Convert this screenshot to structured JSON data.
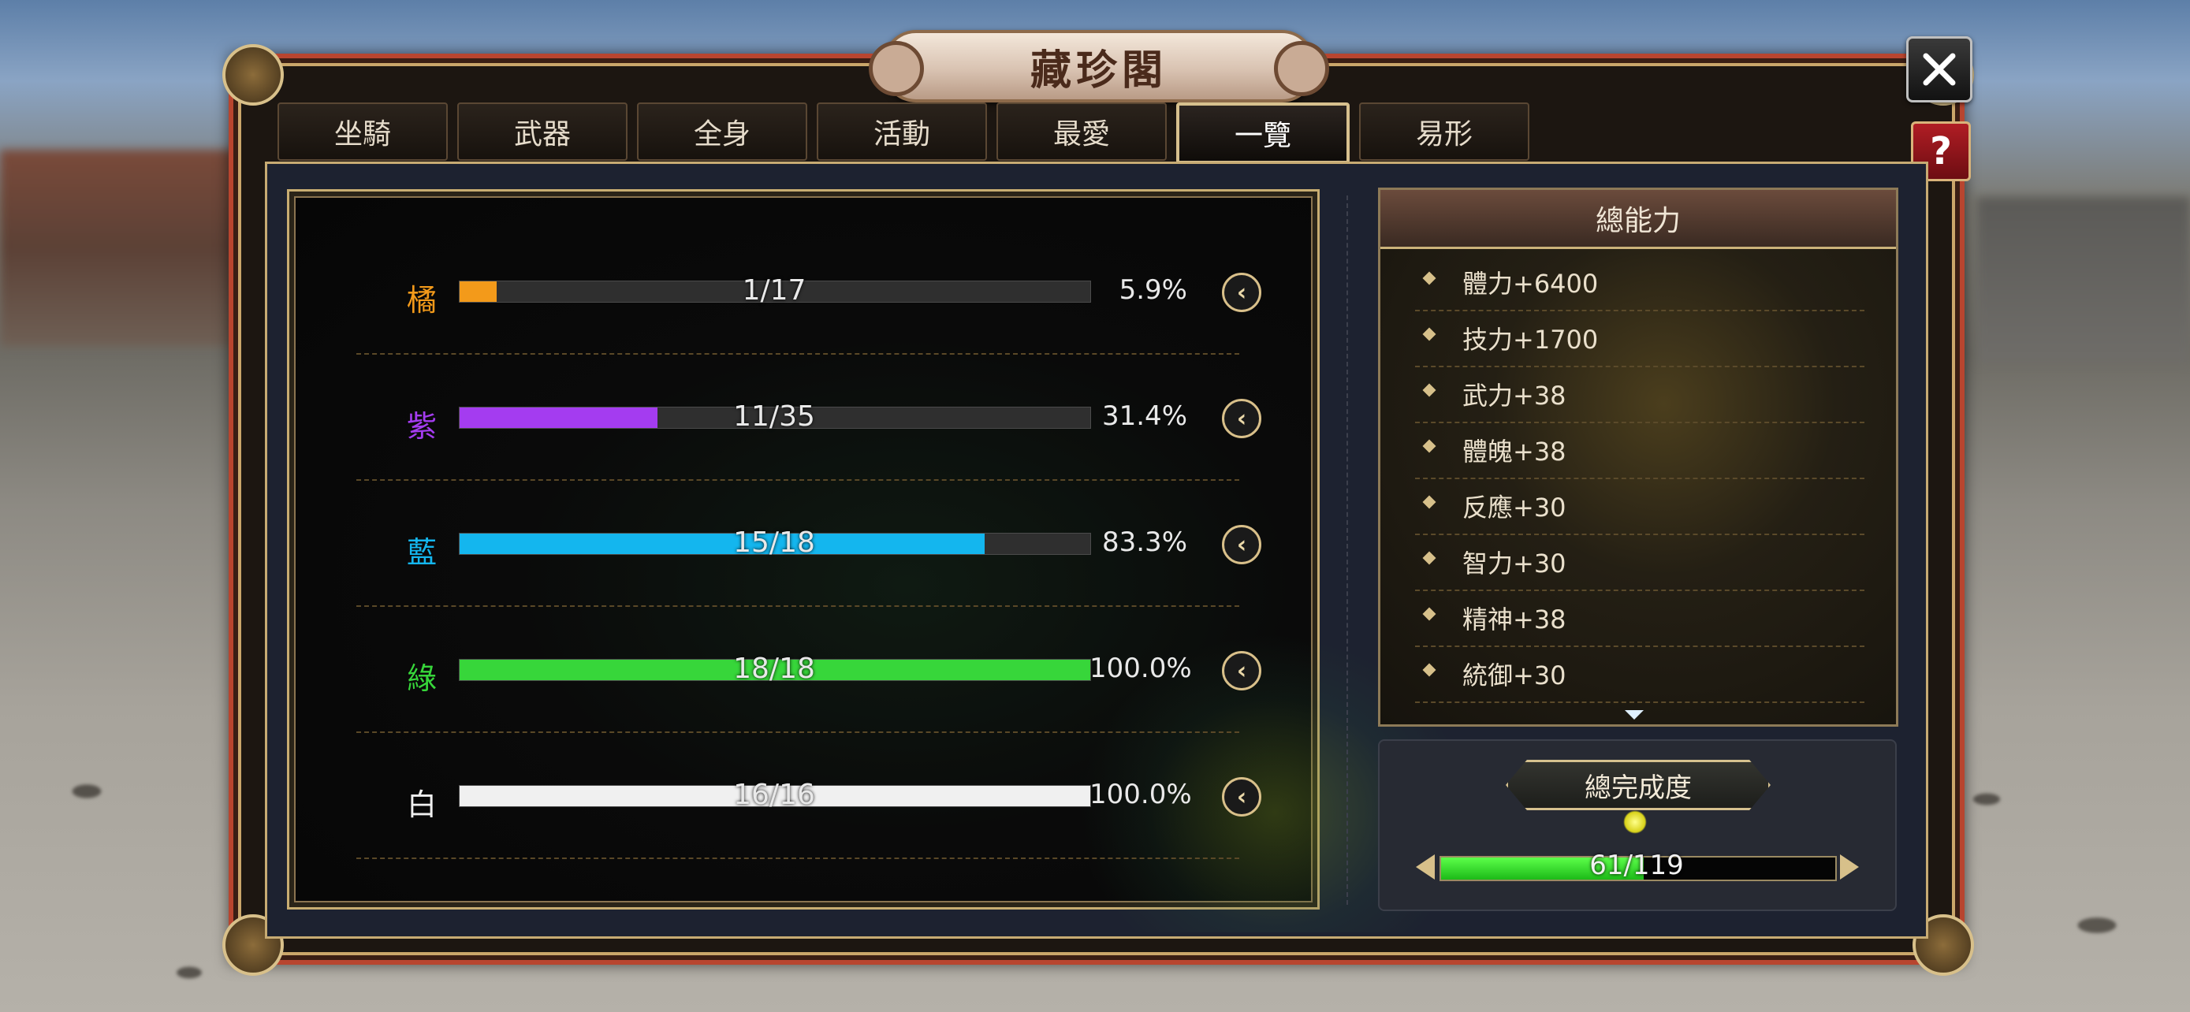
{
  "window": {
    "title": "藏珍閣"
  },
  "buttons": {
    "close_icon": "close-icon",
    "help_label": "?"
  },
  "tabs": [
    {
      "label": "坐騎"
    },
    {
      "label": "武器"
    },
    {
      "label": "全身"
    },
    {
      "label": "活動"
    },
    {
      "label": "最愛"
    },
    {
      "label": "一覽",
      "active": true
    },
    {
      "label": "易形"
    }
  ],
  "rarity_rows": [
    {
      "label": "橘",
      "progress": "1/17",
      "percent": "5.9%",
      "fraction": 0.059,
      "color": "#f39a1a"
    },
    {
      "label": "紫",
      "progress": "11/35",
      "percent": "31.4%",
      "fraction": 0.314,
      "color": "#a43cf0"
    },
    {
      "label": "藍",
      "progress": "15/18",
      "percent": "83.3%",
      "fraction": 0.833,
      "color": "#14b6ee"
    },
    {
      "label": "綠",
      "progress": "18/18",
      "percent": "100.0%",
      "fraction": 1.0,
      "color": "#37d63a"
    },
    {
      "label": "白",
      "progress": "16/16",
      "percent": "100.0%",
      "fraction": 1.0,
      "color": "#f0f0f0"
    }
  ],
  "stats": {
    "header": "總能力",
    "items": [
      "體力+6400",
      "技力+1700",
      "武力+38",
      "體魄+38",
      "反應+30",
      "智力+30",
      "精神+38",
      "統御+30"
    ]
  },
  "completion": {
    "title": "總完成度",
    "progress": "61/119",
    "fraction": 0.513
  }
}
